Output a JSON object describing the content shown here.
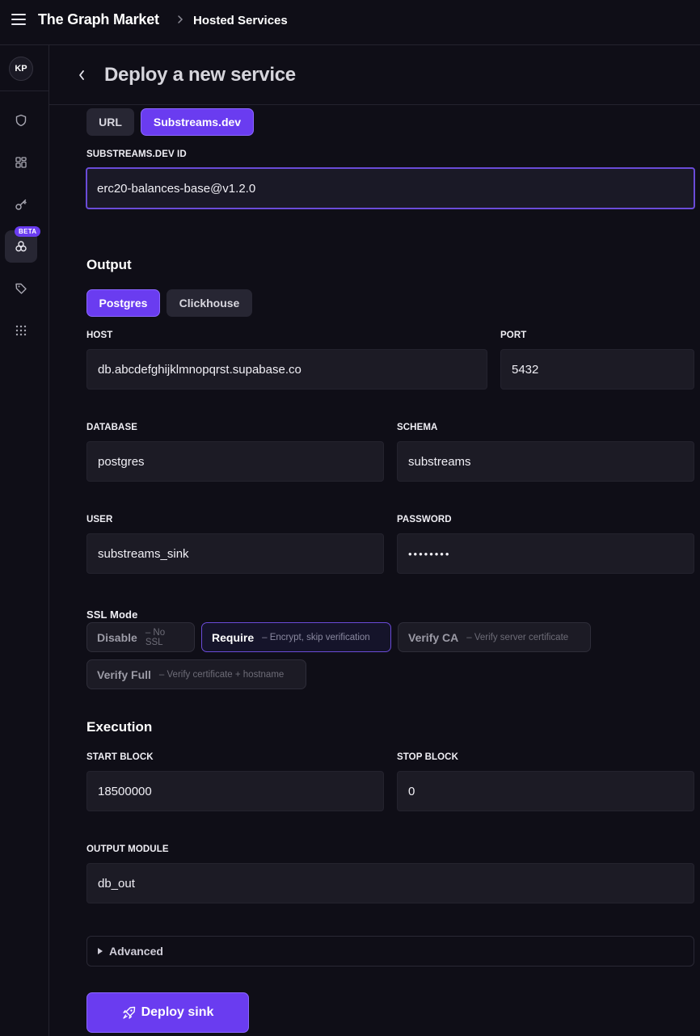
{
  "topbar": {
    "brand": "The Graph Market",
    "breadcrumb": "Hosted Services"
  },
  "sidebar": {
    "avatar": "KP",
    "beta_badge": "BETA",
    "icons": [
      "shield-icon",
      "dashboard-icon",
      "key-icon",
      "substreams-icon",
      "tag-icon",
      "apps-grid-icon"
    ]
  },
  "header": {
    "title": "Deploy a new service"
  },
  "source": {
    "tabs": [
      "URL",
      "Substreams.dev"
    ],
    "active_tab": "Substreams.dev",
    "id_label": "SUBSTREAMS.DEV ID",
    "id_value": "erc20-balances-base@v1.2.0"
  },
  "output": {
    "title": "Output",
    "tabs": [
      "Postgres",
      "Clickhouse"
    ],
    "active_tab": "Postgres",
    "host_label": "HOST",
    "host_value": "db.abcdefghijklmnopqrst.supabase.co",
    "port_label": "PORT",
    "port_value": "5432",
    "database_label": "DATABASE",
    "database_value": "postgres",
    "schema_label": "SCHEMA",
    "schema_value": "substreams",
    "user_label": "USER",
    "user_value": "substreams_sink",
    "password_label": "PASSWORD",
    "password_value": "••••••••",
    "ssl_label": "SSL Mode",
    "ssl_options": [
      {
        "title": "Disable",
        "desc": "– No SSL"
      },
      {
        "title": "Require",
        "desc": "– Encrypt, skip verification"
      },
      {
        "title": "Verify CA",
        "desc": "– Verify server certificate"
      },
      {
        "title": "Verify Full",
        "desc": "– Verify certificate + hostname"
      }
    ],
    "ssl_selected": "Require"
  },
  "execution": {
    "title": "Execution",
    "start_label": "START BLOCK",
    "start_value": "18500000",
    "stop_label": "STOP BLOCK",
    "stop_value": "0",
    "module_label": "OUTPUT MODULE",
    "module_value": "db_out"
  },
  "advanced": {
    "label": "Advanced"
  },
  "deploy": {
    "label": "Deploy sink"
  },
  "colors": {
    "accent": "#6a3cf0",
    "background": "#0f0e17",
    "input_bg": "#1c1b25"
  }
}
